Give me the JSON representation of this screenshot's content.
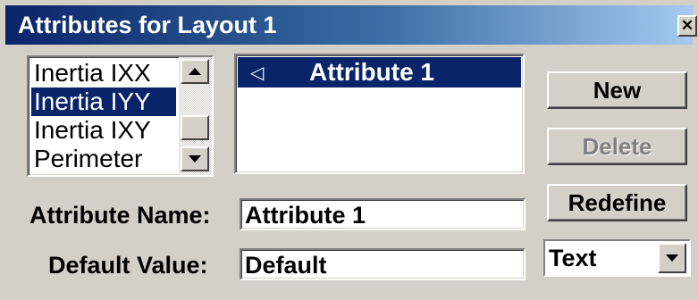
{
  "window": {
    "title": "Attributes for Layout 1",
    "close_glyph": "✕"
  },
  "attribute_types": {
    "items": [
      "Inertia IXX",
      "Inertia IYY",
      "Inertia IXY",
      "Perimeter"
    ],
    "selected": "Inertia IYY"
  },
  "attributes": {
    "items": [
      {
        "label": "Attribute 1",
        "icon": "left-arrow-icon",
        "selected": true
      }
    ]
  },
  "buttons": {
    "new": "New",
    "delete": "Delete",
    "delete_enabled": false,
    "redefine": "Redefine"
  },
  "fields": {
    "name_label": "Attribute Name:",
    "name_value": "Attribute 1",
    "default_label": "Default Value:",
    "default_value": "Default"
  },
  "type_select": {
    "value": "Text"
  },
  "colors": {
    "selection": "#0a246a",
    "face": "#d4d0c8"
  }
}
